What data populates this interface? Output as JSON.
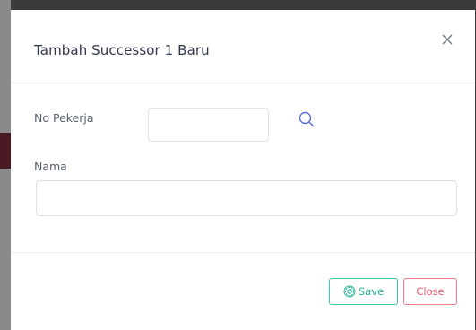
{
  "modal": {
    "title": "Tambah Successor 1 Baru",
    "close_icon": "close-icon"
  },
  "form": {
    "no_pekerja": {
      "label": "No Pekerja",
      "value": "",
      "placeholder": ""
    },
    "nama": {
      "label": "Nama",
      "value": "",
      "placeholder": ""
    },
    "search_icon": "search-icon"
  },
  "footer": {
    "save_label": "Save",
    "save_icon": "gear-icon",
    "close_label": "Close"
  },
  "colors": {
    "save": "#1fb496",
    "close": "#ef5b72",
    "search_icon": "#5b6fd6"
  }
}
